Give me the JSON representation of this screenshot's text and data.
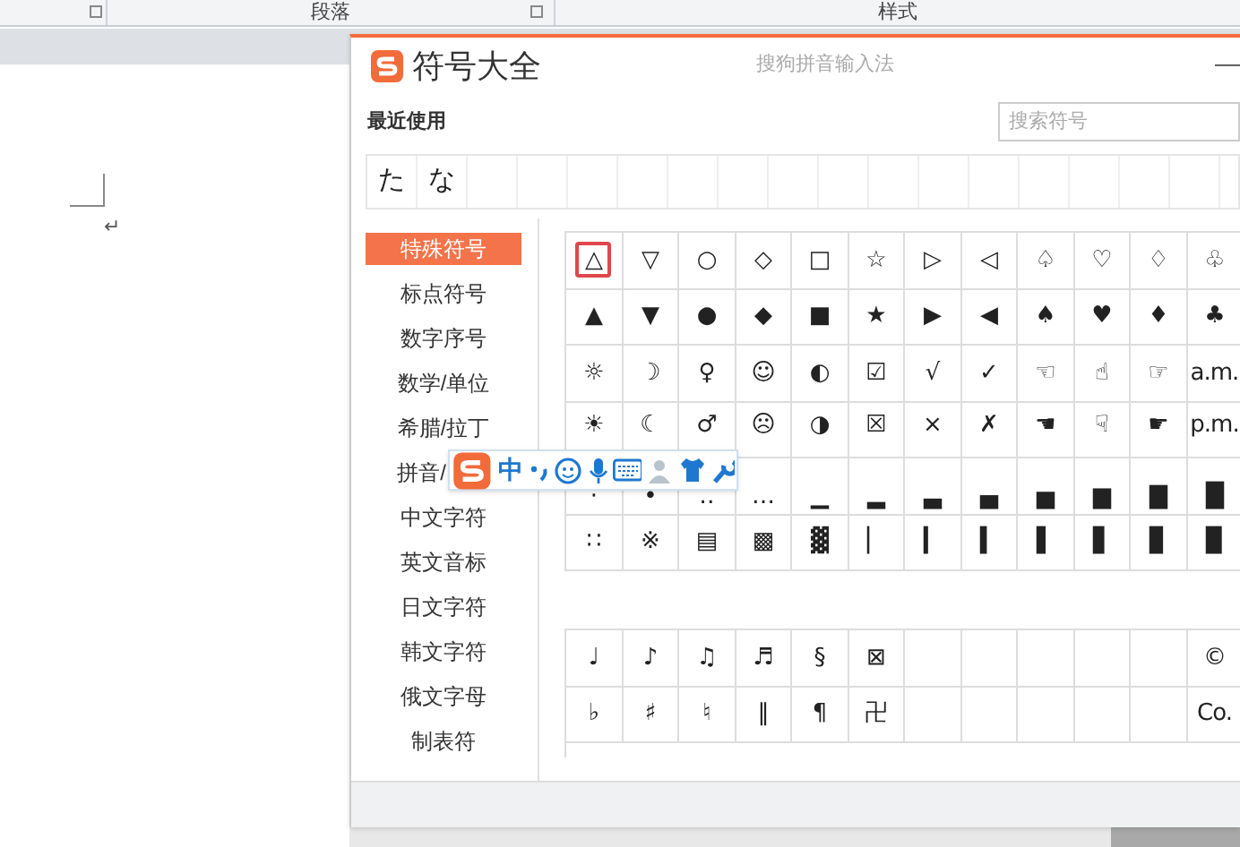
{
  "ribbon": {
    "groups": [
      {
        "label": "段落"
      },
      {
        "label": "样式"
      }
    ]
  },
  "document": {
    "paragraph_mark": "↵"
  },
  "dialog": {
    "title": "符号大全",
    "subtitle": "搜狗拼音输入法",
    "minimize": "—",
    "recent_label": "最近使用",
    "search": {
      "placeholder": "搜索符号"
    },
    "recent": [
      "た",
      "な"
    ],
    "categories": [
      {
        "label": "特殊符号",
        "selected": true
      },
      {
        "label": "标点符号",
        "selected": false
      },
      {
        "label": "数字序号",
        "selected": false
      },
      {
        "label": "数学/单位",
        "selected": false
      },
      {
        "label": "希腊/拉丁",
        "selected": false
      },
      {
        "label": "拼音/",
        "selected": false
      },
      {
        "label": "中文字符",
        "selected": false
      },
      {
        "label": "英文音标",
        "selected": false
      },
      {
        "label": "日文字符",
        "selected": false
      },
      {
        "label": "韩文字符",
        "selected": false
      },
      {
        "label": "俄文字母",
        "selected": false
      },
      {
        "label": "制表符",
        "selected": false
      }
    ],
    "grids": [
      {
        "rows": [
          [
            {
              "symbol": "△",
              "selected": true
            },
            {
              "symbol": "▽",
              "selected": false
            },
            {
              "symbol": "○",
              "selected": false
            },
            {
              "symbol": "◇",
              "selected": false
            },
            {
              "symbol": "□",
              "selected": false
            },
            {
              "symbol": "☆",
              "selected": false
            },
            {
              "symbol": "▷",
              "selected": false
            },
            {
              "symbol": "◁",
              "selected": false
            },
            {
              "symbol": "♤",
              "selected": false
            },
            {
              "symbol": "♡",
              "selected": false
            },
            {
              "symbol": "♢",
              "selected": false
            },
            {
              "symbol": "♧",
              "selected": false
            }
          ],
          [
            {
              "symbol": "▲",
              "selected": false
            },
            {
              "symbol": "▼",
              "selected": false
            },
            {
              "symbol": "●",
              "selected": false
            },
            {
              "symbol": "◆",
              "selected": false
            },
            {
              "symbol": "■",
              "selected": false
            },
            {
              "symbol": "★",
              "selected": false
            },
            {
              "symbol": "▶",
              "selected": false
            },
            {
              "symbol": "◀",
              "selected": false
            },
            {
              "symbol": "♠",
              "selected": false
            },
            {
              "symbol": "♥",
              "selected": false
            },
            {
              "symbol": "♦",
              "selected": false
            },
            {
              "symbol": "♣",
              "selected": false
            }
          ],
          [
            {
              "symbol": "☼",
              "selected": false
            },
            {
              "symbol": "☽",
              "selected": false
            },
            {
              "symbol": "♀",
              "selected": false
            },
            {
              "symbol": "☺",
              "selected": false
            },
            {
              "symbol": "◐",
              "selected": false
            },
            {
              "symbol": "☑",
              "selected": false
            },
            {
              "symbol": "√",
              "selected": false
            },
            {
              "symbol": "✓",
              "selected": false
            },
            {
              "symbol": "☜",
              "selected": false
            },
            {
              "symbol": "☝",
              "selected": false
            },
            {
              "symbol": "☞",
              "selected": false
            },
            {
              "symbol": "a.m.",
              "selected": false
            }
          ],
          [
            {
              "symbol": "☀",
              "selected": false
            },
            {
              "symbol": "☾",
              "selected": false
            },
            {
              "symbol": "♂",
              "selected": false
            },
            {
              "symbol": "☹",
              "selected": false
            },
            {
              "symbol": "◑",
              "selected": false
            },
            {
              "symbol": "☒",
              "selected": false
            },
            {
              "symbol": "×",
              "selected": false
            },
            {
              "symbol": "✗",
              "selected": false
            },
            {
              "symbol": "☚",
              "selected": false
            },
            {
              "symbol": "☟",
              "selected": false
            },
            {
              "symbol": "☛",
              "selected": false
            },
            {
              "symbol": "p.m.",
              "selected": false
            }
          ],
          [
            {
              "symbol": "·",
              "selected": false
            },
            {
              "symbol": "•",
              "selected": false
            },
            {
              "symbol": "‥",
              "selected": false
            },
            {
              "symbol": "…",
              "selected": false
            },
            {
              "symbol": "▁",
              "selected": false
            },
            {
              "symbol": "▂",
              "selected": false
            },
            {
              "symbol": "▃",
              "selected": false
            },
            {
              "symbol": "▄",
              "selected": false
            },
            {
              "symbol": "▅",
              "selected": false
            },
            {
              "symbol": "▆",
              "selected": false
            },
            {
              "symbol": "▇",
              "selected": false
            },
            {
              "symbol": "█",
              "selected": false
            }
          ],
          [
            {
              "symbol": "∷",
              "selected": false
            },
            {
              "symbol": "※",
              "selected": false
            },
            {
              "symbol": "▤",
              "selected": false
            },
            {
              "symbol": "▩",
              "selected": false
            },
            {
              "symbol": "▓",
              "selected": false
            },
            {
              "symbol": "▏",
              "selected": false
            },
            {
              "symbol": "▎",
              "selected": false
            },
            {
              "symbol": "▍",
              "selected": false
            },
            {
              "symbol": "▌",
              "selected": false
            },
            {
              "symbol": "▋",
              "selected": false
            },
            {
              "symbol": "▊",
              "selected": false
            },
            {
              "symbol": "▉",
              "selected": false
            }
          ]
        ]
      },
      {
        "rows": [
          [
            {
              "symbol": "♩",
              "selected": false
            },
            {
              "symbol": "♪",
              "selected": false
            },
            {
              "symbol": "♫",
              "selected": false
            },
            {
              "symbol": "♬",
              "selected": false
            },
            {
              "symbol": "§",
              "selected": false
            },
            {
              "symbol": "⊠",
              "selected": false
            },
            {
              "selected": false
            },
            {
              "selected": false
            },
            {
              "selected": false
            },
            {
              "selected": false
            },
            {
              "selected": false
            },
            {
              "symbol": "©",
              "selected": false
            }
          ],
          [
            {
              "symbol": "♭",
              "selected": false
            },
            {
              "symbol": "♯",
              "selected": false
            },
            {
              "symbol": "♮",
              "selected": false
            },
            {
              "symbol": "‖",
              "selected": false
            },
            {
              "symbol": "¶",
              "selected": false
            },
            {
              "symbol": "卍",
              "selected": false
            },
            {
              "selected": false
            },
            {
              "selected": false
            },
            {
              "selected": false
            },
            {
              "selected": false
            },
            {
              "selected": false
            },
            {
              "symbol": "Co.",
              "selected": false
            }
          ]
        ]
      }
    ]
  },
  "ime_toolbar": {
    "mode": "中"
  }
}
